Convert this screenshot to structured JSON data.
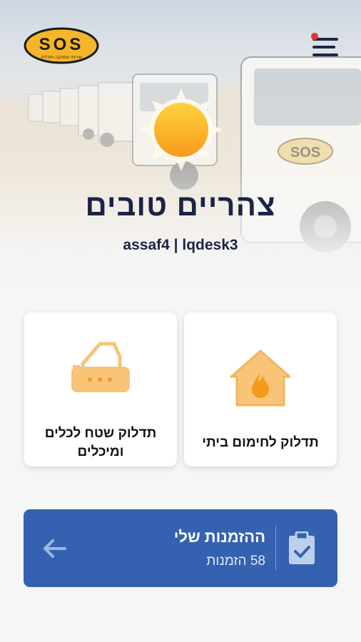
{
  "header": {
    "logo_text": "SOS",
    "logo_subtext": "שירותי אספקה ותדלוק",
    "menu_icon": "hamburger-menu-icon",
    "notification_dot_color": "#e8323c"
  },
  "greeting": {
    "weather_icon": "sun-icon",
    "text": "צהריים טובים",
    "user_line": "assaf4 | lqdesk3"
  },
  "services": [
    {
      "label": "תדלוק לחימום ביתי",
      "icon": "home-heating-icon"
    },
    {
      "label": "תדלוק שטח לכלים ומיכלים",
      "icon": "bulldozer-icon"
    }
  ],
  "orders": {
    "title": "ההזמנות שלי",
    "count_text": "58 הזמנות",
    "icon": "clipboard-check-icon",
    "arrow_icon": "arrow-left-icon",
    "color": "#3562b0"
  },
  "colors": {
    "accent": "#f7c478",
    "text_dark": "#1b2444"
  }
}
